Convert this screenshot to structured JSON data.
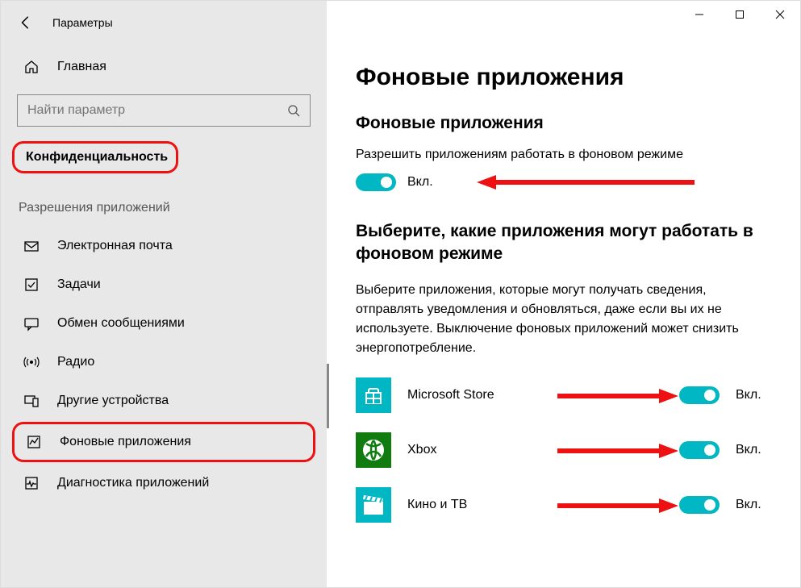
{
  "window": {
    "title": "Параметры"
  },
  "sidebar": {
    "home": "Главная",
    "search_placeholder": "Найти параметр",
    "category": "Конфиденциальность",
    "group_header": "Разрешения приложений",
    "items": [
      {
        "icon": "mail-icon",
        "label": "Электронная почта"
      },
      {
        "icon": "tasks-icon",
        "label": "Задачи"
      },
      {
        "icon": "message-icon",
        "label": "Обмен сообщениями"
      },
      {
        "icon": "radio-icon",
        "label": "Радио"
      },
      {
        "icon": "devices-icon",
        "label": "Другие устройства"
      },
      {
        "icon": "bgapps-icon",
        "label": "Фоновые приложения"
      },
      {
        "icon": "diag-icon",
        "label": "Диагностика приложений"
      }
    ]
  },
  "main": {
    "page_title": "Фоновые приложения",
    "section1_title": "Фоновые приложения",
    "allow_label": "Разрешить приложениям работать в фоновом режиме",
    "allow_state": "Вкл.",
    "section2_title": "Выберите, какие приложения могут работать в фоновом режиме",
    "section2_body": "Выберите приложения, которые могут получать сведения, отправлять уведомления и обновляться, даже если вы их не используете. Выключение фоновых приложений может снизить энергопотребление.",
    "apps": [
      {
        "name": "Microsoft Store",
        "state": "Вкл.",
        "icon": "store-icon",
        "color": "#00b7c3"
      },
      {
        "name": "Xbox",
        "state": "Вкл.",
        "icon": "xbox-icon",
        "color": "#107c10"
      },
      {
        "name": "Кино и ТВ",
        "state": "Вкл.",
        "icon": "movies-icon",
        "color": "#00b7c3"
      }
    ]
  }
}
